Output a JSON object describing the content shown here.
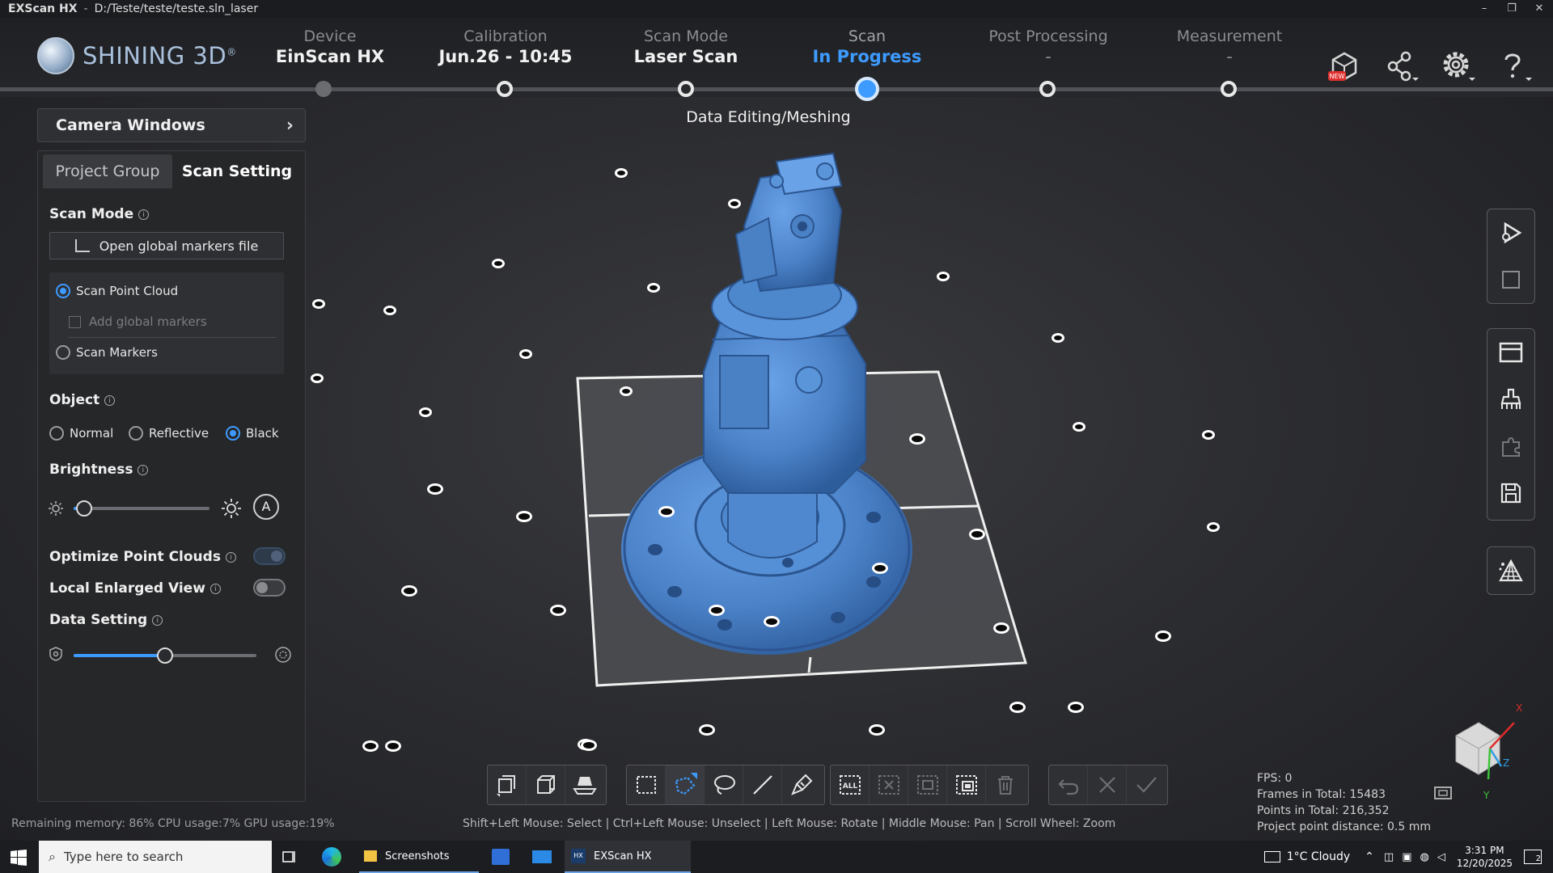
{
  "titlebar": {
    "app": "EXScan HX",
    "separator": "-",
    "path": "D:/Teste/teste/teste.sln_laser"
  },
  "window_controls": {
    "minimize": "–",
    "maximize": "❐",
    "close": "✕"
  },
  "logo": {
    "text": "SHINING 3D",
    "mark": "®"
  },
  "steps": [
    {
      "label": "Device",
      "value": "EinScan HX"
    },
    {
      "label": "Calibration",
      "value": "Jun.26 - 10:45"
    },
    {
      "label": "Scan Mode",
      "value": "Laser Scan"
    },
    {
      "label": "Scan",
      "value": "In Progress"
    },
    {
      "label": "Post Processing",
      "value": "-"
    },
    {
      "label": "Measurement",
      "value": "-"
    }
  ],
  "header_icons": [
    "new-feature-icon",
    "share-icon",
    "settings-icon",
    "help-icon"
  ],
  "substage": "Data Editing/Meshing",
  "camera_windows": {
    "label": "Camera Windows",
    "chevron": "›"
  },
  "tabs": {
    "project_group": "Project Group",
    "scan_setting": "Scan Setting"
  },
  "scan_mode": {
    "title": "Scan Mode",
    "open_markers_button": "Open global markers file",
    "options": {
      "point_cloud": "Scan Point Cloud",
      "add_markers": "Add  global markers",
      "markers": "Scan Markers"
    },
    "selected": "point_cloud"
  },
  "object": {
    "title": "Object",
    "options": [
      "Normal",
      "Reflective",
      "Black"
    ],
    "selected": "Black"
  },
  "brightness": {
    "title": "Brightness",
    "level": 0.08,
    "auto_label": "A"
  },
  "optimize": {
    "title": "Optimize Point Clouds",
    "enabled": true
  },
  "local_view": {
    "title": "Local Enlarged View",
    "enabled": false
  },
  "data_setting": {
    "title": "Data Setting",
    "level": 0.5
  },
  "right_toolbar": [
    "play-icon",
    "stop-icon",
    "window-icon",
    "cleaner-icon",
    "puzzle-icon",
    "save-icon",
    "mesh-icon"
  ],
  "bottom_toolbar": {
    "group1": [
      "select-visible-icon",
      "select-through-icon",
      "plane-cut-icon"
    ],
    "group2": [
      "rect-select-icon",
      "polygon-select-icon",
      "lasso-select-icon",
      "line-select-icon",
      "brush-select-icon"
    ],
    "group3": [
      "select-all-icon",
      "deselect-icon",
      "invert-select-icon",
      "select-connected-icon",
      "delete-icon"
    ],
    "group4": [
      "undo-icon",
      "cancel-icon",
      "apply-icon"
    ],
    "all_label": "ALL"
  },
  "stats": {
    "fps": "FPS:  0",
    "frames": "Frames in Total: 15483",
    "points": "Points in Total: 216,352",
    "distance": "Project point distance: 0.5 mm"
  },
  "status": "Remaining memory: 86% CPU usage:7%  GPU usage:19%",
  "hint": "Shift+Left Mouse: Select | Ctrl+Left Mouse: Unselect | Left Mouse: Rotate | Middle Mouse: Pan | Scroll Wheel: Zoom",
  "orientation": {
    "x": "X",
    "y": "Y",
    "z": "Z"
  },
  "taskbar": {
    "search_placeholder": "Type here to search",
    "apps": [
      "Screenshots",
      "EXScan HX"
    ],
    "weather": "1°C  Cloudy",
    "time": "3:31 PM",
    "date": "12/20/2025",
    "notifications": "2"
  }
}
